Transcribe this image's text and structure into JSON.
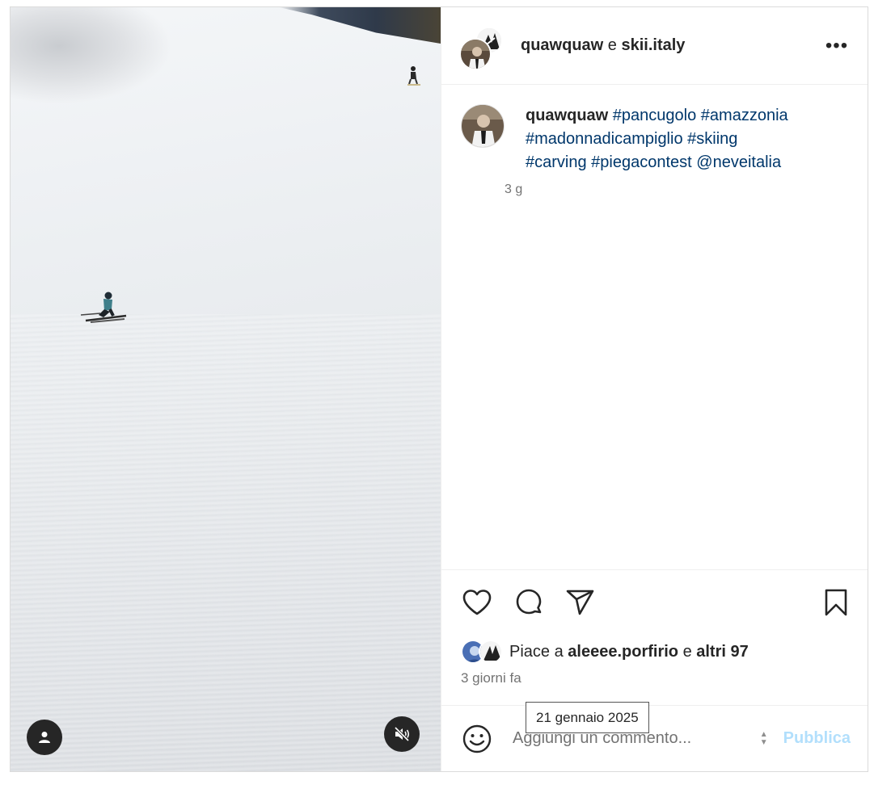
{
  "header": {
    "username_1": "quawquaw",
    "joiner": "e",
    "username_2": "skii.italy",
    "more_label": "•••"
  },
  "caption": {
    "user": "quawquaw",
    "hashtags_line1": [
      "#pancugolo",
      "#amazzonia"
    ],
    "hashtags_line2": [
      "#madonnadicampiglio",
      "#skiing"
    ],
    "hashtags_line3": [
      "#carving",
      "#piegacontest"
    ],
    "mention": "@neveitalia",
    "time": "3 g"
  },
  "media": {
    "user_tag_icon": "user-icon",
    "mute_icon": "speaker-muted-icon"
  },
  "actions": {
    "like_icon": "heart-icon",
    "comment_icon": "comment-icon",
    "share_icon": "send-icon",
    "save_icon": "bookmark-icon"
  },
  "likes": {
    "prefix": "Piace a",
    "liker": "aleeee.porfirio",
    "joiner": "e",
    "others": "altri 97"
  },
  "post_date": "3 giorni fa",
  "tooltip": "21 gennaio 2025",
  "comment": {
    "placeholder": "Aggiungi un commento...",
    "publish_label": "Pubblica",
    "emoji_icon": "smiley-icon"
  },
  "colors": {
    "hashtag": "#00376b",
    "muted_text": "#737373",
    "publish_disabled": "#b2dffc"
  }
}
